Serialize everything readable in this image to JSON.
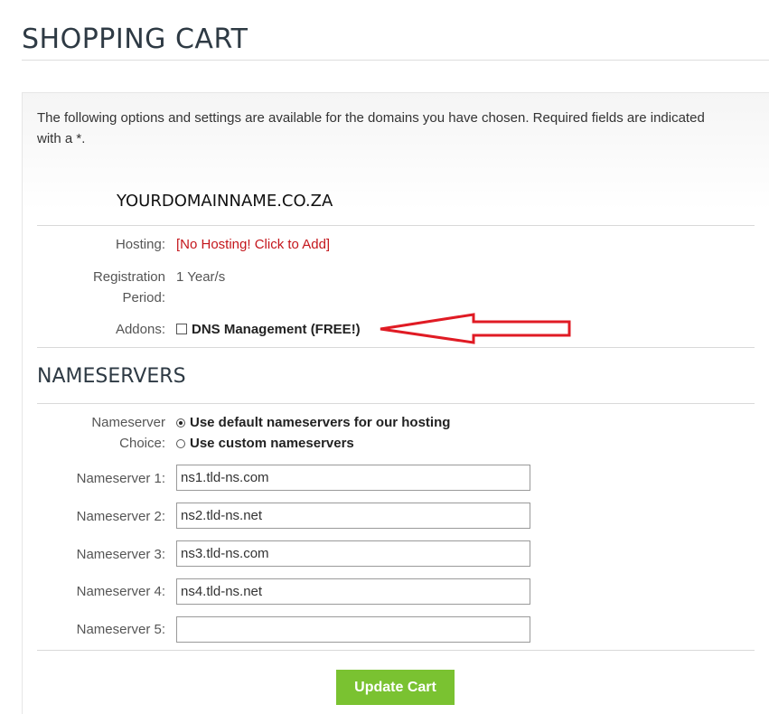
{
  "page": {
    "title": "SHOPPING CART"
  },
  "intro_text": "The following options and settings are available for the domains you have chosen. Required fields are indicated with a *.",
  "domain": {
    "name": "YOURDOMAINNAME.CO.ZA",
    "hosting_label": "Hosting:",
    "hosting_link": "[No Hosting! Click to Add]",
    "period_label_1": "Registration",
    "period_label_2": "Period:",
    "period_value": "1 Year/s",
    "addons_label": "Addons:",
    "addon_dns": "DNS Management (FREE!)",
    "addon_dns_checked": false
  },
  "nameservers": {
    "section_title": "NAMESERVERS",
    "choice_label_1": "Nameserver",
    "choice_label_2": "Choice:",
    "option_default": "Use default nameservers for our hosting",
    "option_custom": "Use custom nameservers",
    "selected": "default",
    "fields": [
      {
        "label": "Nameserver 1:",
        "value": "ns1.tld-ns.com"
      },
      {
        "label": "Nameserver 2:",
        "value": "ns2.tld-ns.net"
      },
      {
        "label": "Nameserver 3:",
        "value": "ns3.tld-ns.com"
      },
      {
        "label": "Nameserver 4:",
        "value": "ns4.tld-ns.net"
      },
      {
        "label": "Nameserver 5:",
        "value": ""
      }
    ]
  },
  "actions": {
    "update_label": "Update Cart"
  },
  "colors": {
    "accent_green": "#7ac231",
    "link_red": "#c4161c",
    "annotation_red": "#e01b24"
  }
}
